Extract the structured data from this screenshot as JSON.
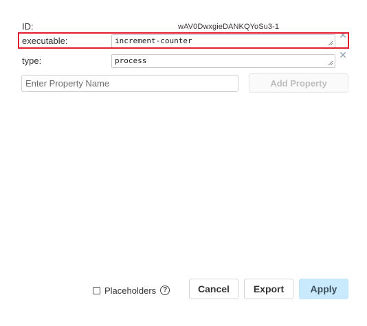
{
  "properties": {
    "id": {
      "label": "ID:",
      "value": "wAV0DwxgieDANKQYoSu3-1"
    },
    "executable": {
      "label": "executable:",
      "value": "increment-counter",
      "remove_icon": "close-icon"
    },
    "type": {
      "label": "type:",
      "value": "process",
      "remove_icon": "close-icon"
    }
  },
  "add_property": {
    "placeholder": "Enter Property Name",
    "button_label": "Add Property"
  },
  "footer": {
    "placeholders_label": "Placeholders",
    "help_icon": "help-icon",
    "cancel_label": "Cancel",
    "export_label": "Export",
    "apply_label": "Apply"
  },
  "colors": {
    "highlight": "#e11d2e",
    "apply_bg": "#c9e9fd",
    "remove_icon": "#8aa0b5"
  }
}
